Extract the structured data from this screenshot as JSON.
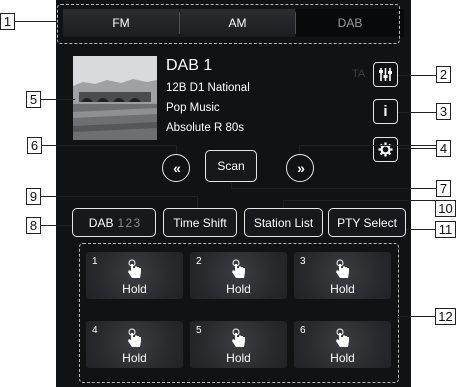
{
  "tabs": [
    {
      "label": "FM",
      "selected": false
    },
    {
      "label": "AM",
      "selected": false
    },
    {
      "label": "DAB",
      "selected": true
    }
  ],
  "station": {
    "name": "DAB 1",
    "ensemble": "12B  D1 National",
    "genre": "Pop Music",
    "programme": "Absolute R 80s",
    "ta_indicator": "TA"
  },
  "side_buttons": [
    {
      "icon": "equalizer-icon"
    },
    {
      "icon": "info-icon",
      "glyph": "i"
    },
    {
      "icon": "gear-icon"
    }
  ],
  "controls": {
    "seek_back": "«",
    "scan_label": "Scan",
    "seek_forward": "»"
  },
  "bottom_buttons": {
    "band_label": "DAB",
    "band_numbers": "1 2 3",
    "time_shift": "Time Shift",
    "station_list": "Station List",
    "pty_select": "PTY Select"
  },
  "presets": [
    {
      "number": "1",
      "label": "Hold"
    },
    {
      "number": "2",
      "label": "Hold"
    },
    {
      "number": "3",
      "label": "Hold"
    },
    {
      "number": "4",
      "label": "Hold"
    },
    {
      "number": "5",
      "label": "Hold"
    },
    {
      "number": "6",
      "label": "Hold"
    }
  ],
  "callouts": [
    "1",
    "2",
    "3",
    "4",
    "5",
    "6",
    "7",
    "8",
    "9",
    "10",
    "11",
    "12"
  ]
}
